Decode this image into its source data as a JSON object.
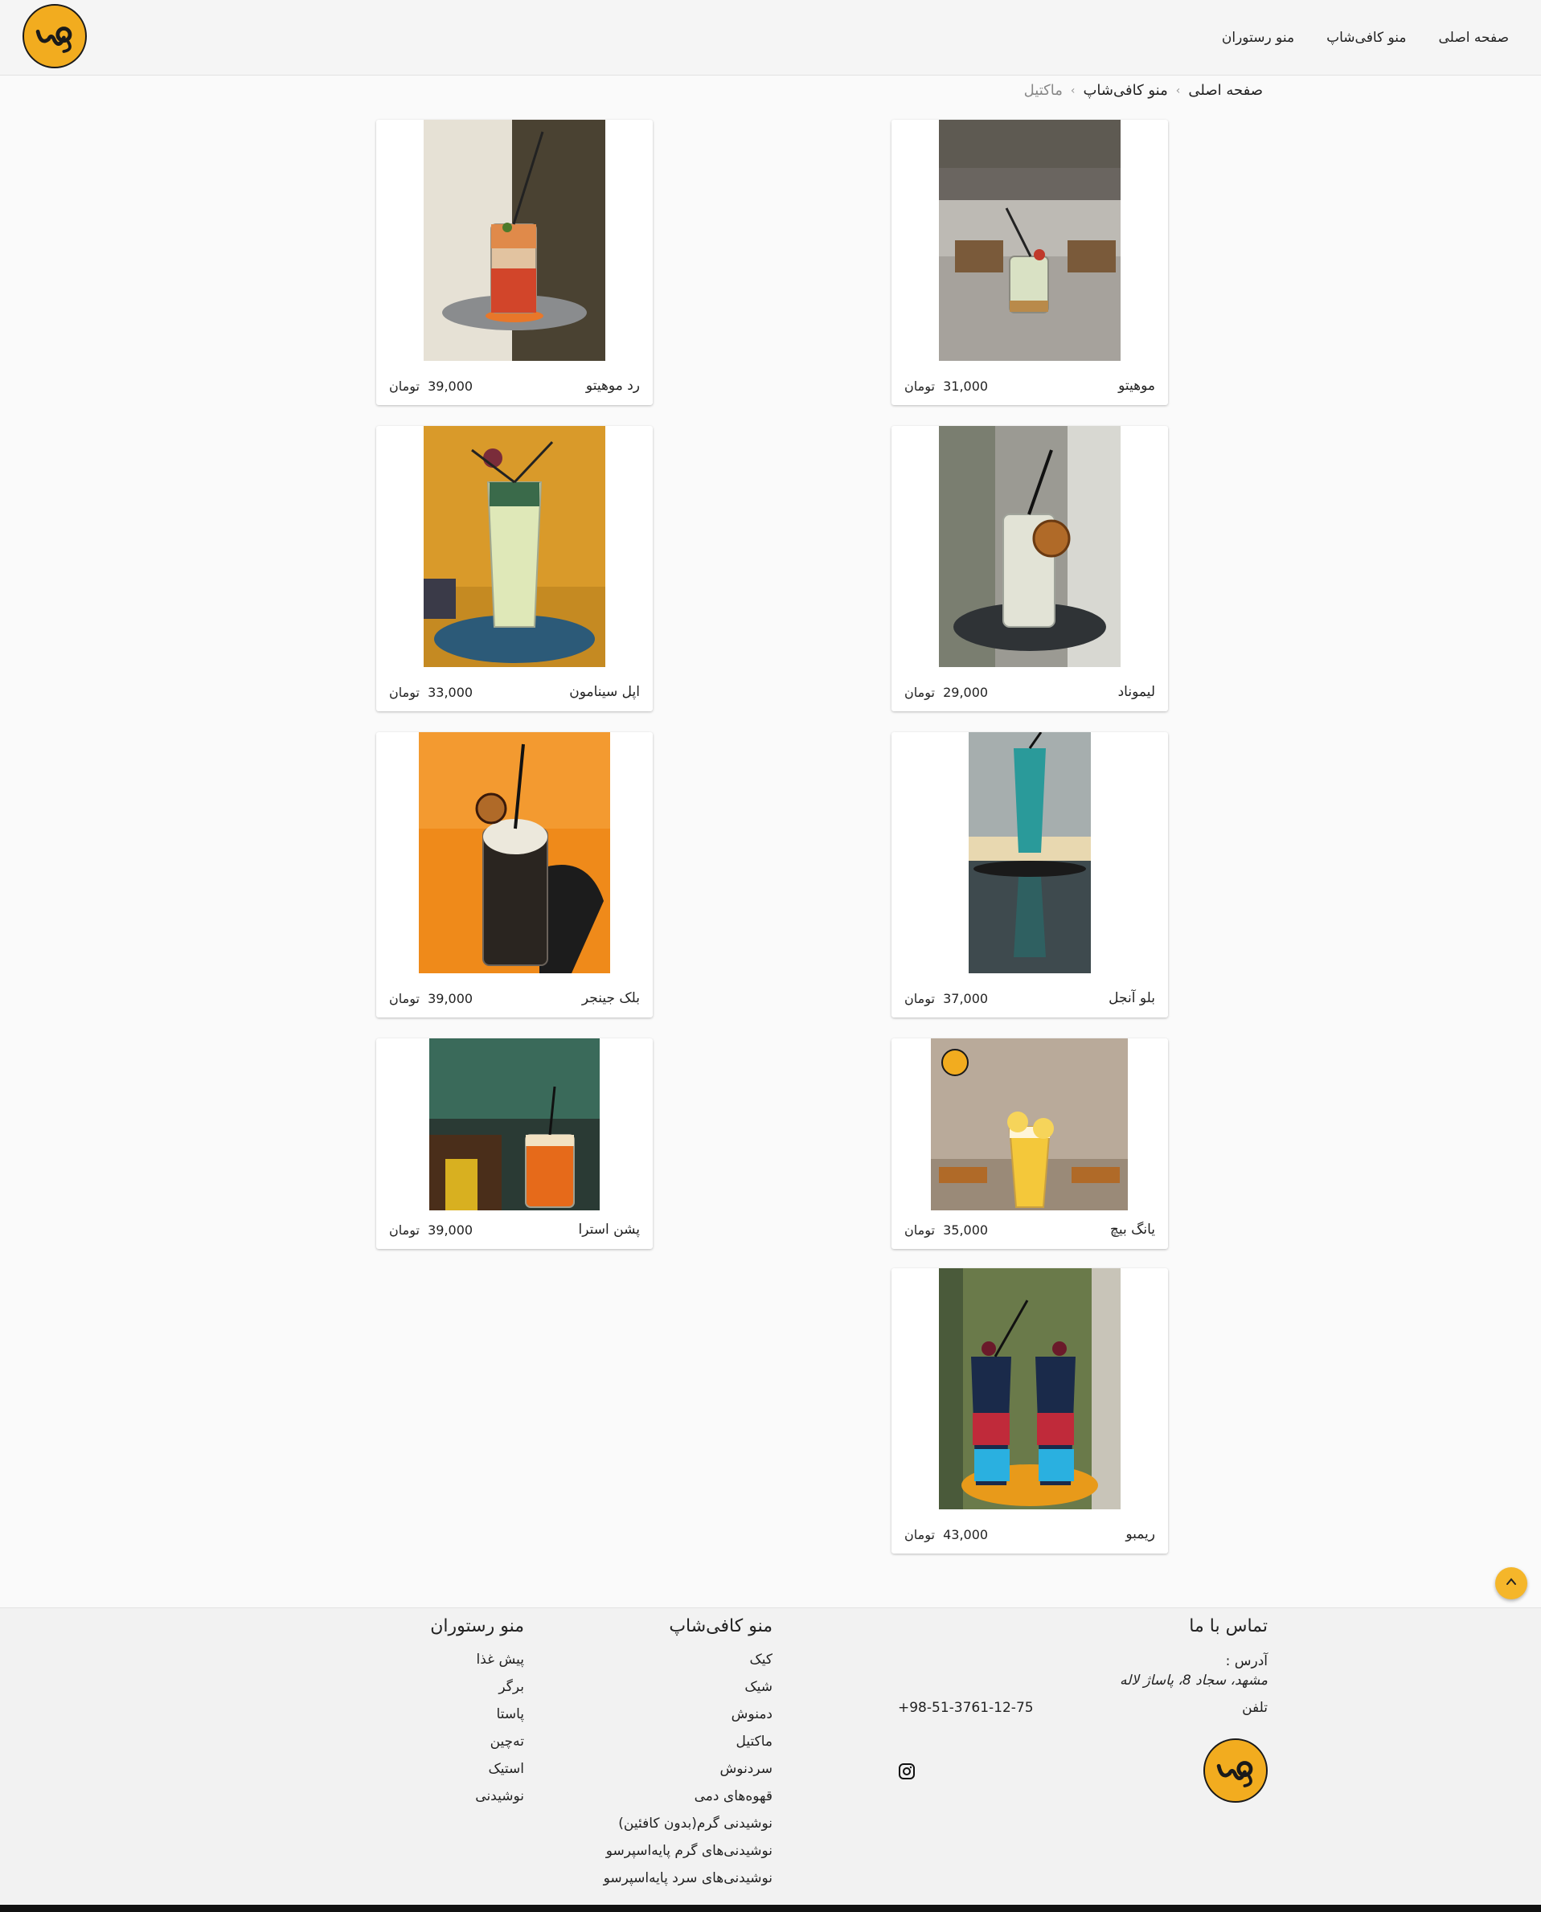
{
  "header": {
    "nav": [
      {
        "label": "صفحه اصلی"
      },
      {
        "label": "منو کافی‌شاپ"
      },
      {
        "label": "منو رستوران"
      }
    ]
  },
  "breadcrumb": {
    "items": [
      "صفحه اصلی",
      "منو کافی‌شاپ"
    ],
    "current": "ماکتیل",
    "separator": "›"
  },
  "products": [
    {
      "name": "موهیتو",
      "price": "31,000",
      "currency": "تومان"
    },
    {
      "name": "رد موهیتو",
      "price": "39,000",
      "currency": "تومان"
    },
    {
      "name": "لیموناد",
      "price": "29,000",
      "currency": "تومان"
    },
    {
      "name": "اپل سینامون",
      "price": "33,000",
      "currency": "تومان"
    },
    {
      "name": "بلو آنجل",
      "price": "37,000",
      "currency": "تومان"
    },
    {
      "name": "بلک جینجر",
      "price": "39,000",
      "currency": "تومان"
    },
    {
      "name": "یانگ بیچ",
      "price": "35,000",
      "currency": "تومان"
    },
    {
      "name": "پشن استرا",
      "price": "39,000",
      "currency": "تومان"
    },
    {
      "name": "ریمبو",
      "price": "43,000",
      "currency": "تومان"
    }
  ],
  "footer": {
    "contact": {
      "title": "تماس با ما",
      "address_label": "آدرس :",
      "address": "مشهد، سجاد 8، پاساژ لاله",
      "phone_label": "تلفن",
      "phone": "+98-51-3761-12-75",
      "social_icon": "instagram-icon"
    },
    "cafe_menu": {
      "title": "منو کافی‌شاپ",
      "items": [
        "کیک",
        "شیک",
        "دمنوش",
        "ماکتیل",
        "سردنوش",
        "قهوه‌های دمی",
        "نوشیدنی گرم(بدون کافئین)",
        "نوشیدنی‌های گرم پایه‌اسپرسو",
        "نوشیدنی‌های سرد پایه‌اسپرسو"
      ]
    },
    "restaurant_menu": {
      "title": "منو رستوران",
      "items": [
        "پیش غذا",
        "برگر",
        "پاستا",
        "ته‌چین",
        "استیک",
        "نوشیدنی"
      ]
    }
  },
  "colors": {
    "brand": "#f2ac1f",
    "background": "#fafafa"
  }
}
